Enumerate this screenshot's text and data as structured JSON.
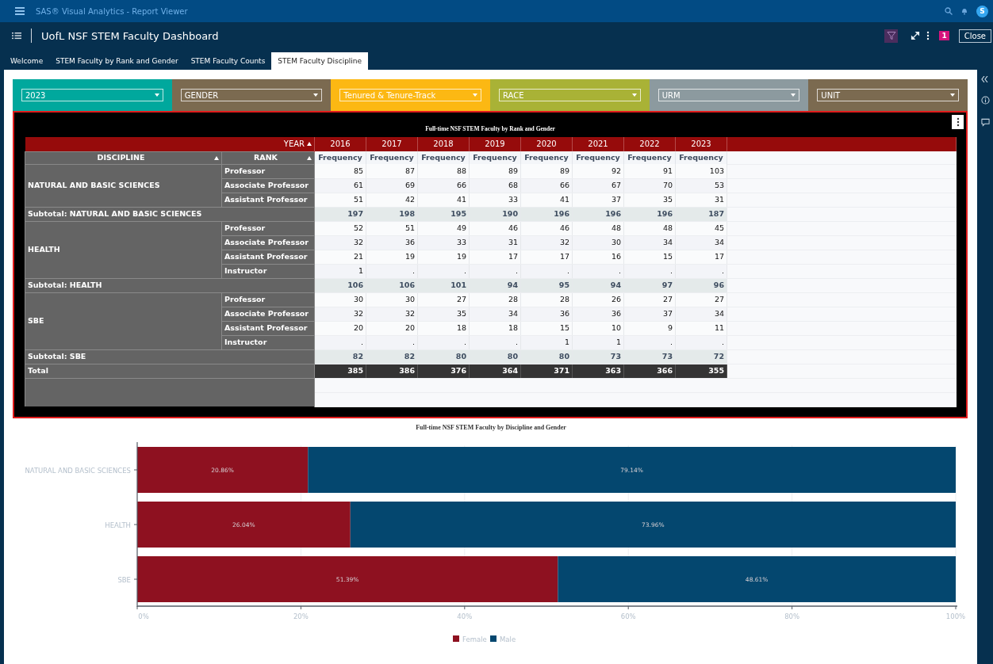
{
  "app_bar": {
    "title": "SAS® Visual Analytics - Report Viewer",
    "avatar": "S"
  },
  "report": {
    "title": "UofL NSF STEM Faculty Dashboard",
    "badge": "1",
    "close_label": "Close"
  },
  "tabs": [
    {
      "label": "Welcome",
      "selected": false
    },
    {
      "label": "STEM Faculty by Rank and Gender",
      "selected": false
    },
    {
      "label": "STEM Faculty Counts",
      "selected": false
    },
    {
      "label": "STEM Faculty Discipline",
      "selected": true
    }
  ],
  "filters": [
    {
      "value": "2023",
      "color": "#00a89d"
    },
    {
      "value": "GENDER",
      "color": "#7b6a50"
    },
    {
      "value": "Tenured & Tenure-Track",
      "color": "#fcb813"
    },
    {
      "value": "RACE",
      "color": "#a9b236"
    },
    {
      "value": "URM",
      "color": "#8c9a9f"
    },
    {
      "value": "UNIT",
      "color": "#7b6a50"
    }
  ],
  "crosstab": {
    "title": "Full-time NSF STEM Faculty by Rank and Gender",
    "year_header": "YEAR",
    "discipline_header": "DISCIPLINE",
    "rank_header": "RANK",
    "columns": [
      {
        "year": "2016",
        "measure": "Frequency"
      },
      {
        "year": "2017",
        "measure": "Frequency"
      },
      {
        "year": "2018",
        "measure": "Frequency"
      },
      {
        "year": "2019",
        "measure": "Frequency"
      },
      {
        "year": "2020",
        "measure": "Frequency"
      },
      {
        "year": "2021",
        "measure": "Frequency"
      },
      {
        "year": "2022",
        "measure": "Frequency"
      },
      {
        "year": "2023",
        "measure": "Frequency"
      }
    ],
    "groups": [
      {
        "discipline": "NATURAL AND BASIC SCIENCES",
        "rows": [
          {
            "rank": "Professor",
            "values": [
              "85",
              "87",
              "88",
              "89",
              "89",
              "92",
              "91",
              "103"
            ]
          },
          {
            "rank": "Associate Professor",
            "values": [
              "61",
              "69",
              "66",
              "68",
              "66",
              "67",
              "70",
              "53"
            ]
          },
          {
            "rank": "Assistant Professor",
            "values": [
              "51",
              "42",
              "41",
              "33",
              "41",
              "37",
              "35",
              "31"
            ]
          }
        ],
        "subtotal": {
          "label": "Subtotal: NATURAL AND BASIC SCIENCES",
          "values": [
            "197",
            "198",
            "195",
            "190",
            "196",
            "196",
            "196",
            "187"
          ]
        }
      },
      {
        "discipline": "HEALTH",
        "rows": [
          {
            "rank": "Professor",
            "values": [
              "52",
              "51",
              "49",
              "46",
              "46",
              "48",
              "48",
              "45"
            ]
          },
          {
            "rank": "Associate Professor",
            "values": [
              "32",
              "36",
              "33",
              "31",
              "32",
              "30",
              "34",
              "34"
            ]
          },
          {
            "rank": "Assistant Professor",
            "values": [
              "21",
              "19",
              "19",
              "17",
              "17",
              "16",
              "15",
              "17"
            ]
          },
          {
            "rank": "Instructor",
            "values": [
              "1",
              ".",
              ".",
              ".",
              ".",
              ".",
              ".",
              "."
            ]
          }
        ],
        "subtotal": {
          "label": "Subtotal: HEALTH",
          "values": [
            "106",
            "106",
            "101",
            "94",
            "95",
            "94",
            "97",
            "96"
          ]
        }
      },
      {
        "discipline": "SBE",
        "rows": [
          {
            "rank": "Professor",
            "values": [
              "30",
              "30",
              "27",
              "28",
              "28",
              "26",
              "27",
              "27"
            ]
          },
          {
            "rank": "Associate Professor",
            "values": [
              "32",
              "32",
              "35",
              "34",
              "36",
              "36",
              "37",
              "34"
            ]
          },
          {
            "rank": "Assistant Professor",
            "values": [
              "20",
              "20",
              "18",
              "18",
              "15",
              "10",
              "9",
              "11"
            ]
          },
          {
            "rank": "Instructor",
            "values": [
              ".",
              ".",
              ".",
              ".",
              "1",
              "1",
              ".",
              "."
            ]
          }
        ],
        "subtotal": {
          "label": "Subtotal: SBE",
          "values": [
            "82",
            "82",
            "80",
            "80",
            "80",
            "73",
            "73",
            "72"
          ]
        }
      }
    ],
    "total": {
      "label": "Total",
      "values": [
        "385",
        "386",
        "376",
        "364",
        "371",
        "363",
        "366",
        "355"
      ]
    }
  },
  "chart": {
    "chart_data": {
      "type": "bar",
      "orientation": "horizontal",
      "stacked": true,
      "title": "Full-time NSF STEM Faculty by Discipline and Gender",
      "categories": [
        "NATURAL AND BASIC SCIENCES",
        "HEALTH",
        "SBE"
      ],
      "series": [
        {
          "name": "Female",
          "color": "#8e1120",
          "values": [
            20.86,
            26.04,
            51.39
          ]
        },
        {
          "name": "Male",
          "color": "#04476f",
          "values": [
            79.14,
            73.96,
            48.61
          ]
        }
      ],
      "xlim": [
        0,
        100
      ],
      "grid": true,
      "legend": true,
      "xticks": [
        {
          "value": 0,
          "label": "0%"
        },
        {
          "value": 20,
          "label": "20%"
        },
        {
          "value": 40,
          "label": "40%"
        },
        {
          "value": 60,
          "label": "60%"
        },
        {
          "value": 80,
          "label": "80%"
        },
        {
          "value": 100,
          "label": "100%"
        }
      ],
      "value_labels": [
        [
          "20.86%",
          "26.04%",
          "51.39%"
        ],
        [
          "79.14%",
          "73.96%",
          "48.61%"
        ]
      ]
    }
  }
}
